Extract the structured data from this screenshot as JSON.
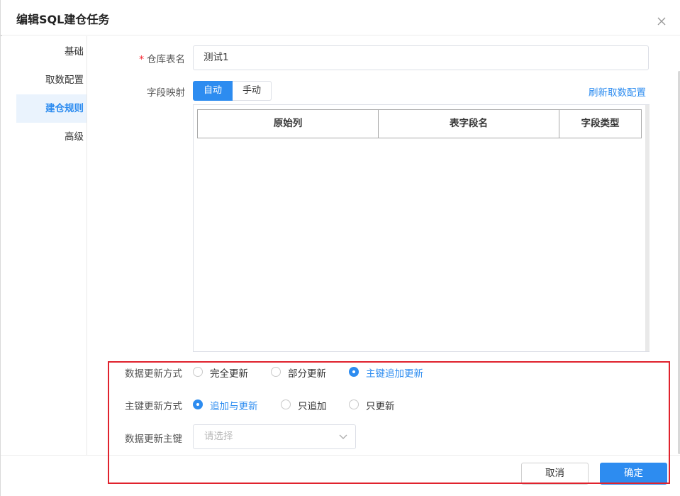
{
  "dialog": {
    "title": "编辑SQL建仓任务"
  },
  "sidebar": {
    "items": [
      {
        "label": "基础",
        "active": false
      },
      {
        "label": "取数配置",
        "active": false
      },
      {
        "label": "建仓规则",
        "active": true
      },
      {
        "label": "高级",
        "active": false
      }
    ]
  },
  "form": {
    "table_name": {
      "label": "仓库表名",
      "value": "测试1",
      "required": true
    },
    "field_mapping": {
      "label": "字段映射",
      "options": [
        "自动",
        "手动"
      ],
      "selected": "自动",
      "refresh_link": "刷新取数配置"
    },
    "mapping_table": {
      "columns": [
        "原始列",
        "表字段名",
        "字段类型"
      ],
      "rows": []
    },
    "update_mode": {
      "label": "数据更新方式",
      "options": [
        "完全更新",
        "部分更新",
        "主键追加更新"
      ],
      "selected": "主键追加更新"
    },
    "key_update_mode": {
      "label": "主键更新方式",
      "options": [
        "追加与更新",
        "只追加",
        "只更新"
      ],
      "selected": "追加与更新"
    },
    "update_key": {
      "label": "数据更新主键",
      "placeholder": "请选择"
    }
  },
  "footer": {
    "cancel_label": "取消",
    "ok_label": "确定"
  },
  "colors": {
    "accent": "#2d8cf0",
    "highlight_border": "#e0222d",
    "required": "#f5222d"
  }
}
